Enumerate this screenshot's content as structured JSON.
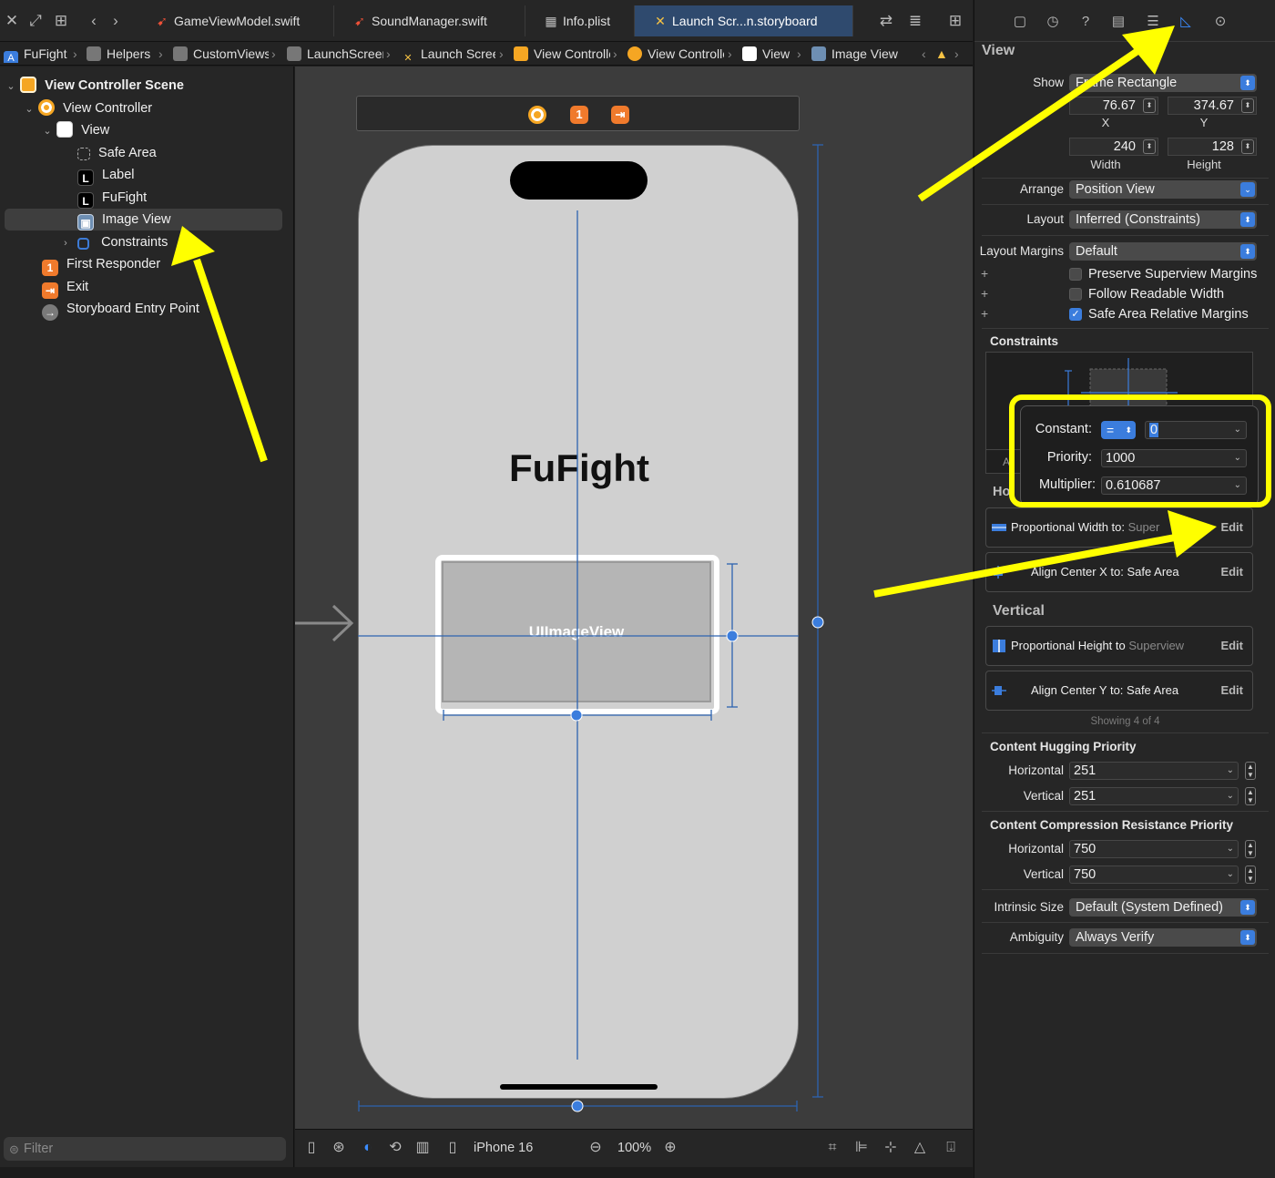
{
  "tabs": [
    {
      "label": "GameViewModel.swift",
      "icon": "swift-file-icon"
    },
    {
      "label": "SoundManager.swift",
      "icon": "swift-file-icon"
    },
    {
      "label": "Info.plist",
      "icon": "plist-icon"
    },
    {
      "label": "Launch Scr...n.storyboard",
      "icon": "storyboard-icon"
    }
  ],
  "breadcrumb": [
    {
      "label": "FuFight",
      "icon": "project-icon"
    },
    {
      "label": "Helpers",
      "icon": "folder-icon"
    },
    {
      "label": "CustomViews",
      "icon": "folder-icon"
    },
    {
      "label": "LaunchScreen",
      "icon": "folder-icon"
    },
    {
      "label": "Launch Screen",
      "icon": "storyboard-icon"
    },
    {
      "label": "View Controller Scene",
      "icon": "scene-icon"
    },
    {
      "label": "View Controller",
      "icon": "view-controller-icon"
    },
    {
      "label": "View",
      "icon": "view-icon"
    },
    {
      "label": "Image View",
      "icon": "image-view-icon"
    }
  ],
  "navigator": {
    "items": [
      {
        "label": "View Controller Scene",
        "icon": "scene-icon"
      },
      {
        "label": "View Controller",
        "icon": "view-controller-icon"
      },
      {
        "label": "View",
        "icon": "view-icon"
      },
      {
        "label": "Safe Area",
        "icon": "safe-area-icon"
      },
      {
        "label": "Label",
        "icon": "label-icon",
        "glyph": "L"
      },
      {
        "label": "FuFight",
        "icon": "label-icon",
        "glyph": "L"
      },
      {
        "label": "Image View",
        "icon": "image-view-icon"
      },
      {
        "label": "Constraints",
        "icon": "constraints-icon"
      },
      {
        "label": "First Responder",
        "icon": "first-responder-icon",
        "glyph": "1"
      },
      {
        "label": "Exit",
        "icon": "exit-icon"
      },
      {
        "label": "Storyboard Entry Point",
        "icon": "entry-point-icon"
      }
    ],
    "filter_placeholder": "Filter"
  },
  "canvas": {
    "app_title": "FuFight",
    "image_view_label": "UIImageView",
    "dock_glyph": "1",
    "device": "iPhone 16",
    "zoom": "100%"
  },
  "inspector": {
    "section_title": "View",
    "show_label": "Show",
    "show_value": "Frame Rectangle",
    "x_value": "76.67",
    "y_value": "374.67",
    "x_label": "X",
    "y_label": "Y",
    "width_value": "240",
    "height_value": "128",
    "width_label": "Width",
    "height_label": "Height",
    "arrange_label": "Arrange",
    "arrange_value": "Position View",
    "layout_label": "Layout",
    "layout_value": "Inferred (Constraints)",
    "layout_margins_label": "Layout Margins",
    "layout_margins_value": "Default",
    "checkboxes": [
      {
        "label": "Preserve Superview Margins",
        "checked": false
      },
      {
        "label": "Follow Readable Width",
        "checked": false
      },
      {
        "label": "Safe Area Relative Margins",
        "checked": true
      }
    ],
    "constraints_title": "Constraints",
    "constraints_partial_a": "A",
    "horizontal_partial": "Ho",
    "horizontal_constraints": [
      {
        "prefix": "Proportional Width to:",
        "target": "Super",
        "edit": "Edit"
      },
      {
        "prefix": "Align Center X to:",
        "target": "Safe Area",
        "edit": "Edit"
      }
    ],
    "vertical_title": "Vertical",
    "vertical_constraints": [
      {
        "prefix": "Proportional Height to",
        "target": "Superview",
        "edit": "Edit"
      },
      {
        "prefix": "Align Center Y to:",
        "target": "Safe Area",
        "edit": "Edit"
      }
    ],
    "showing_text": "Showing 4 of 4",
    "hugging_title": "Content Hugging Priority",
    "hugging_horizontal_label": "Horizontal",
    "hugging_horizontal_value": "251",
    "hugging_vertical_label": "Vertical",
    "hugging_vertical_value": "251",
    "compression_title": "Content Compression Resistance Priority",
    "compression_horizontal_label": "Horizontal",
    "compression_horizontal_value": "750",
    "compression_vertical_label": "Vertical",
    "compression_vertical_value": "750",
    "intrinsic_label": "Intrinsic Size",
    "intrinsic_value": "Default (System Defined)",
    "ambiguity_label": "Ambiguity",
    "ambiguity_value": "Always Verify"
  },
  "popover": {
    "constant_label": "Constant:",
    "relation": "=",
    "constant_value": "0",
    "priority_label": "Priority:",
    "priority_value": "1000",
    "multiplier_label": "Multiplier:",
    "multiplier_value": "0.610687"
  },
  "colors": {
    "accent": "#3b7ddd",
    "annotation": "#ffff00",
    "active_tab": "#2f4a6e",
    "storyboard_orange": "#f5a623"
  }
}
